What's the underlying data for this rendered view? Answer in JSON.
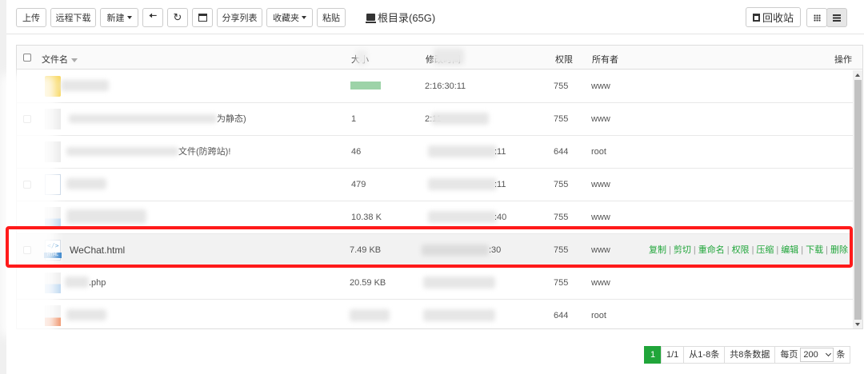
{
  "toolbar": {
    "upload": "上传",
    "remote_download": "远程下载",
    "new": "新建",
    "share_list": "分享列表",
    "favorites": "收藏夹",
    "paste": "粘贴",
    "back_icon": "arrow-left-icon",
    "refresh_icon": "refresh-icon",
    "terminal_icon": "terminal-icon"
  },
  "path": {
    "label": "根目录(65G)"
  },
  "recycle_bin": "回收站",
  "table": {
    "headers": {
      "name": "文件名",
      "size": "大小",
      "modified": "修改时间",
      "permission": "权限",
      "owner": "所有者",
      "actions": "操作"
    },
    "rows": [
      {
        "name": "",
        "size": "",
        "modified": "2:16:30:11",
        "perm": "755",
        "owner": "www",
        "icon": "folder-icon"
      },
      {
        "name": "为静态)",
        "size": "1",
        "modified": "2:11",
        "perm": "755",
        "owner": "www",
        "icon": "document-icon"
      },
      {
        "name": "文件(防跨站)!",
        "size": "46",
        "modified": ":11",
        "perm": "644",
        "owner": "root",
        "icon": "document-icon"
      },
      {
        "name": "",
        "size": "479",
        "modified": ":11",
        "perm": "755",
        "owner": "www",
        "icon": "code-file-icon"
      },
      {
        "name": "",
        "size": "10.38 K",
        "modified": ":40",
        "perm": "755",
        "owner": "www",
        "icon": "php-file-icon"
      },
      {
        "name": "WeChat.html",
        "size": "7.49 KB",
        "modified": ":30",
        "perm": "755",
        "owner": "www",
        "icon": "html-file-icon"
      },
      {
        "name": ".php",
        "size": "20.59 KB",
        "modified": "",
        "perm": "755",
        "owner": "www",
        "icon": "php-file-icon"
      },
      {
        "name": "",
        "size": "",
        "modified": "",
        "perm": "644",
        "owner": "root",
        "icon": "zip-file-icon"
      }
    ],
    "row_actions": [
      "复制",
      "剪切",
      "重命名",
      "权限",
      "压缩",
      "编辑",
      "下载",
      "删除"
    ]
  },
  "html_icon_text": {
    "symbol": "</>",
    "tag": "HTML"
  },
  "pager": {
    "current": "1",
    "page_count": "1/1",
    "range": "从1-8条",
    "total": "共8条数据",
    "per_page_label": "每页",
    "per_page_value": "200",
    "unit": "条"
  },
  "colors": {
    "accent": "#20a53a",
    "highlight_border": "#ff1a1a"
  }
}
